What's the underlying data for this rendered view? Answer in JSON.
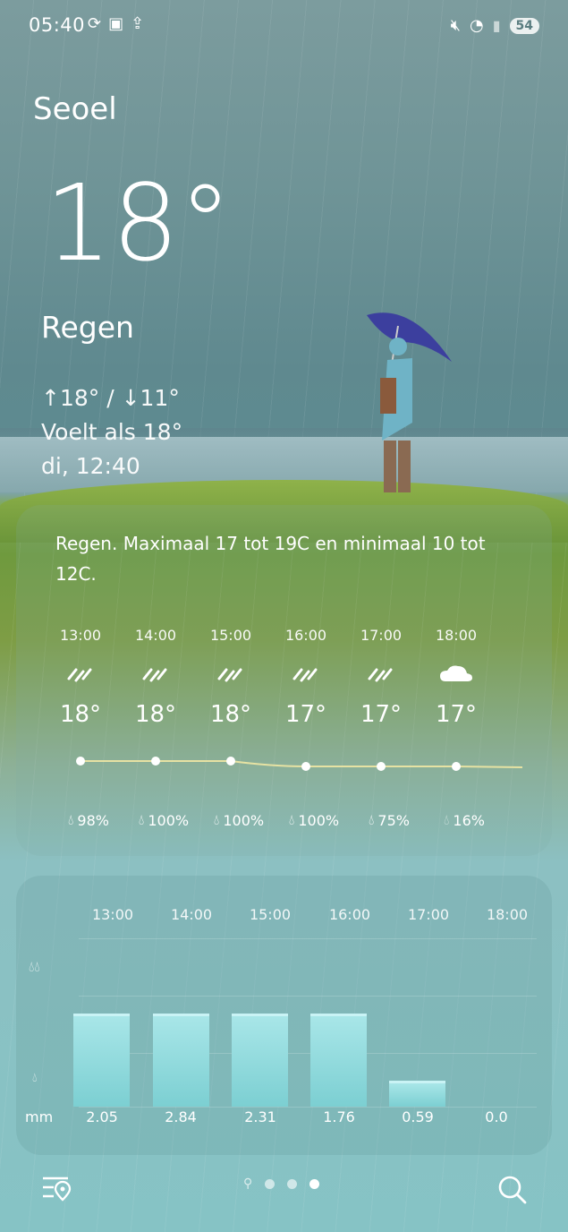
{
  "status_bar": {
    "time": "05:40",
    "battery": "54",
    "left_icons": [
      "sync-off-icon",
      "gallery-icon",
      "upload-icon"
    ],
    "right_icons": [
      "mute-icon",
      "wifi-icon",
      "signal-icon"
    ]
  },
  "current": {
    "city": "Seoel",
    "temperature": "18°",
    "condition": "Regen",
    "high_low": "↑18° / ↓11°",
    "feels_like": "Voelt als 18°",
    "updated": "di, 12:40"
  },
  "hourly": {
    "summary": "Regen. Maximaal 17 tot 19C en minimaal 10 tot 12C.",
    "items": [
      {
        "time": "13:00",
        "icon": "rain-icon",
        "temp": "18°",
        "precip": "98%"
      },
      {
        "time": "14:00",
        "icon": "rain-icon",
        "temp": "18°",
        "precip": "100%"
      },
      {
        "time": "15:00",
        "icon": "rain-icon",
        "temp": "18°",
        "precip": "100%"
      },
      {
        "time": "16:00",
        "icon": "rain-icon",
        "temp": "17°",
        "precip": "100%"
      },
      {
        "time": "17:00",
        "icon": "rain-icon",
        "temp": "17°",
        "precip": "75%"
      },
      {
        "time": "18:00",
        "icon": "cloud-icon",
        "temp": "17°",
        "precip": "16%"
      }
    ]
  },
  "precipitation": {
    "unit": "mm",
    "times": [
      "13:00",
      "14:00",
      "15:00",
      "16:00",
      "17:00",
      "18:00"
    ],
    "values": [
      "2.05",
      "2.84",
      "2.31",
      "1.76",
      "0.59",
      "0.0"
    ]
  },
  "colors": {
    "accent": "#ffffff",
    "bar": "#9fe1e4",
    "line": "#e6e2a3"
  }
}
